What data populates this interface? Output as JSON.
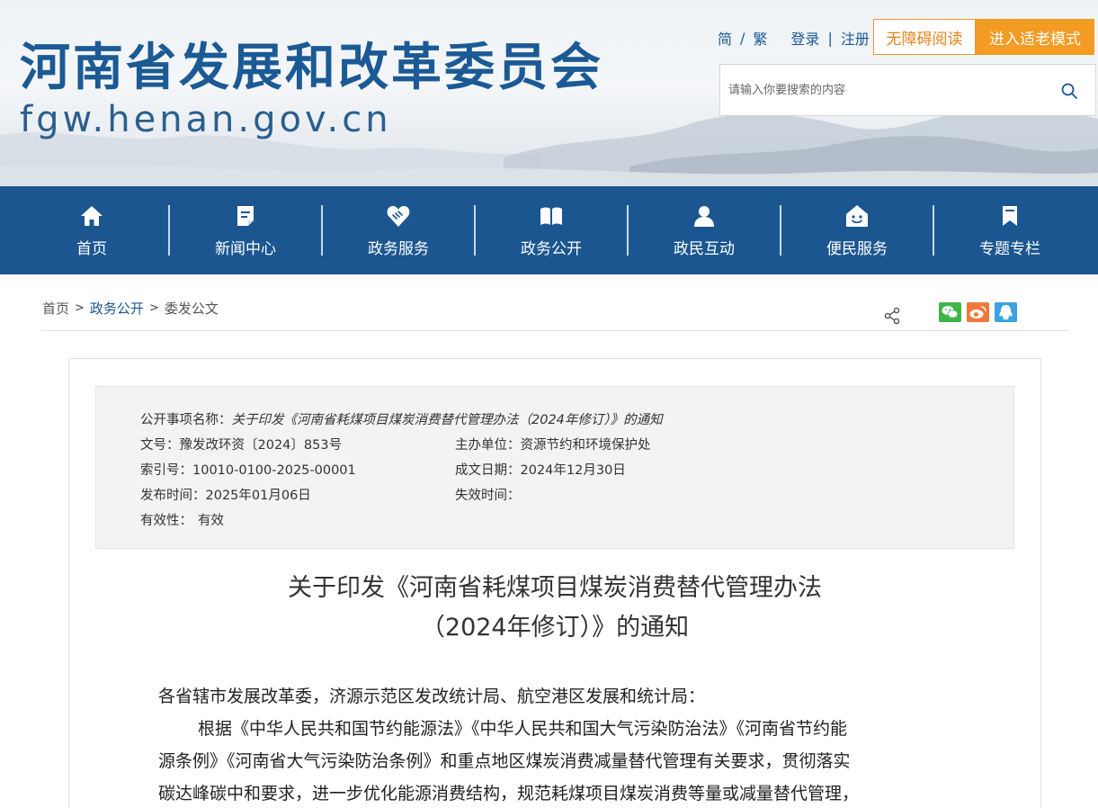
{
  "header": {
    "site_title": "河南省发展和改革委员会",
    "site_domain": "fgw.henan.gov.cn",
    "lang_simplified": "简",
    "lang_slash": "/",
    "lang_traditional": "繁",
    "login": "登录",
    "link_divider": "|",
    "register": "注册",
    "accessible_reading": "无障碍阅读",
    "elderly_mode": "进入适老模式",
    "search_placeholder": "请输入你要搜索的内容",
    "accent_color": "#1b5690",
    "orange_color": "#f39b22"
  },
  "nav": {
    "items": [
      {
        "label": "首页",
        "icon": "home-icon"
      },
      {
        "label": "新闻中心",
        "icon": "document-icon"
      },
      {
        "label": "政务服务",
        "icon": "handshake-heart-icon"
      },
      {
        "label": "政务公开",
        "icon": "open-book-icon"
      },
      {
        "label": "政民互动",
        "icon": "user-icon"
      },
      {
        "label": "便民服务",
        "icon": "smile-house-icon"
      },
      {
        "label": "专题专栏",
        "icon": "bookmark-icon"
      }
    ]
  },
  "breadcrumb": {
    "home": "首页",
    "sep": ">",
    "section": "政务公开",
    "current": "委发公文"
  },
  "share": {
    "icons": [
      "share-icon",
      "wechat-icon",
      "weibo-icon",
      "qq-icon"
    ]
  },
  "meta": {
    "item_name_key": "公开事项名称：",
    "item_name_value": "关于印发《河南省耗煤项目煤炭消费替代管理办法（2024年修订）》的通知",
    "doc_no_key": "文号：",
    "doc_no_value": "豫发改环资〔2024〕853号",
    "dept_key": "主办单位：",
    "dept_value": "资源节约和环境保护处",
    "index_key": "索引号：",
    "index_value": "10010-0100-2025-00001",
    "date_key": "成文日期：",
    "date_value": "2024年12月30日",
    "publish_key": "发布时间：",
    "publish_value": "2025年01月06日",
    "expire_key": "失效时间：",
    "expire_value": "",
    "validity_key": "有效性：",
    "validity_value": "有效"
  },
  "article": {
    "title_line1": "关于印发《河南省耗煤项目煤炭消费替代管理办法",
    "title_line2": "（2024年修订）》的通知",
    "salutation": "各省辖市发展改革委，济源示范区发改统计局、航空港区发展和统计局：",
    "para1_line1": "根据《中华人民共和国节约能源法》《中华人民共和国大气污染防治法》《河南省节约能",
    "para1_line2": "源条例》《河南省大气污染防治条例》和重点地区煤炭消费减量替代管理有关要求，贯彻落实",
    "para1_line3": "碳达峰碳中和要求，进一步优化能源消费结构，规范耗煤项目煤炭消费等量或减量替代管理，"
  }
}
